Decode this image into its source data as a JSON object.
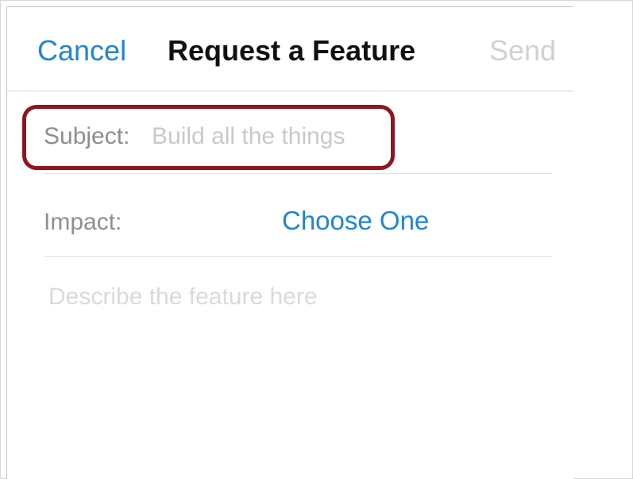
{
  "nav": {
    "cancel_label": "Cancel",
    "title": "Request a Feature",
    "send_label": "Send"
  },
  "form": {
    "subject_label": "Subject:",
    "subject_value": "",
    "subject_placeholder": "Build all the things",
    "impact_label": "Impact:",
    "impact_value": "Choose One",
    "description_value": "",
    "description_placeholder": "Describe the feature here"
  },
  "colors": {
    "accent": "#1f86d4",
    "highlight": "#8f1521",
    "disabled_text": "#d1d1d1",
    "label_text": "#8e8e8e"
  }
}
